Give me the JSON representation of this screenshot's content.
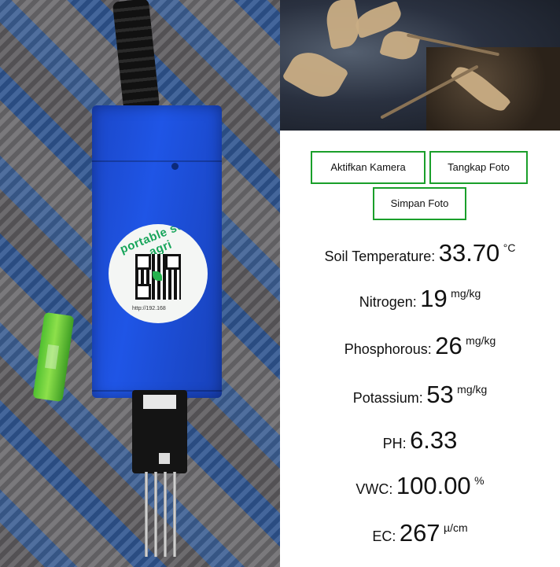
{
  "photo_left": {
    "label_text": "portable soil agri",
    "label_url": "http://192.168"
  },
  "buttons": {
    "activate_camera": "Aktifkan Kamera",
    "capture_photo": "Tangkap Foto",
    "save_photo": "Simpan Foto"
  },
  "readings": [
    {
      "label": "Soil Temperature:",
      "value": "33.70",
      "unit": "°C"
    },
    {
      "label": "Nitrogen:",
      "value": "19",
      "unit": "mg/kg"
    },
    {
      "label": "Phosphorous:",
      "value": "26",
      "unit": "mg/kg"
    },
    {
      "label": "Potassium:",
      "value": "53",
      "unit": "mg/kg"
    },
    {
      "label": "PH:",
      "value": "6.33",
      "unit": ""
    },
    {
      "label": "VWC:",
      "value": "100.00",
      "unit": "%"
    },
    {
      "label": "EC:",
      "value": "267",
      "unit": "µ/cm"
    }
  ],
  "colors": {
    "button_border": "#1a9f2a",
    "bag_blue": "#1f55e6",
    "battery_green": "#6dd23b"
  }
}
